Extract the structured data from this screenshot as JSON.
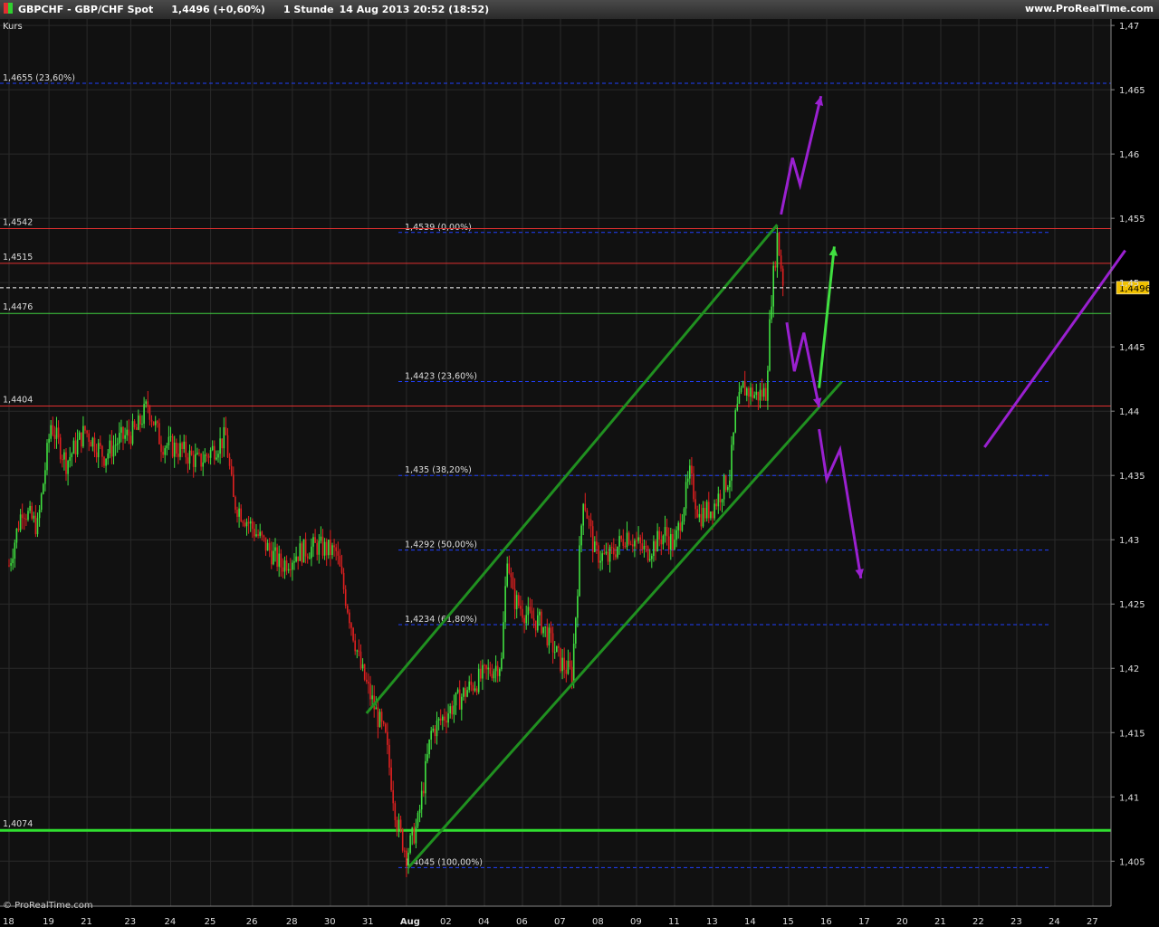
{
  "header": {
    "instrument": "GBPCHF - GBP/CHF Spot",
    "quote": "1,4496 (+0,60%)",
    "timeframe": "1 Stunde",
    "datetime": "14 Aug 2013 20:52 (18:52)",
    "site": "www.ProRealTime.com"
  },
  "chart_data": {
    "type": "candlestick",
    "panel_label": "Kurs",
    "footer": "© ProRealTime.com",
    "ylim": [
      1.4015,
      1.4705
    ],
    "y_ticks": [
      {
        "v": 1.47,
        "t": "1,47"
      },
      {
        "v": 1.465,
        "t": "1,465"
      },
      {
        "v": 1.46,
        "t": "1,46"
      },
      {
        "v": 1.455,
        "t": "1,455"
      },
      {
        "v": 1.45,
        "t": "1,45"
      },
      {
        "v": 1.445,
        "t": "1,445"
      },
      {
        "v": 1.44,
        "t": "1,44"
      },
      {
        "v": 1.435,
        "t": "1,435"
      },
      {
        "v": 1.43,
        "t": "1,43"
      },
      {
        "v": 1.425,
        "t": "1,425"
      },
      {
        "v": 1.42,
        "t": "1,42"
      },
      {
        "v": 1.415,
        "t": "1,415"
      },
      {
        "v": 1.41,
        "t": "1,41"
      },
      {
        "v": 1.405,
        "t": "1,405"
      }
    ],
    "x_ticks": [
      {
        "t": "18",
        "i": 0
      },
      {
        "t": "19",
        "i": 2.1
      },
      {
        "t": "21",
        "i": 4.1
      },
      {
        "t": "23",
        "i": 6.4
      },
      {
        "t": "24",
        "i": 8.5
      },
      {
        "t": "25",
        "i": 10.6
      },
      {
        "t": "26",
        "i": 12.8
      },
      {
        "t": "28",
        "i": 14.9
      },
      {
        "t": "30",
        "i": 16.9
      },
      {
        "t": "31",
        "i": 18.9
      },
      {
        "t": "Aug",
        "i": 20.9,
        "bold": true
      },
      {
        "t": "02",
        "i": 23
      },
      {
        "t": "04",
        "i": 25
      },
      {
        "t": "06",
        "i": 27
      },
      {
        "t": "07",
        "i": 29
      },
      {
        "t": "08",
        "i": 31
      },
      {
        "t": "09",
        "i": 33
      },
      {
        "t": "11",
        "i": 35
      },
      {
        "t": "13",
        "i": 37
      },
      {
        "t": "14",
        "i": 39
      },
      {
        "t": "15",
        "i": 41
      },
      {
        "t": "16",
        "i": 43
      },
      {
        "t": "17",
        "i": 45
      },
      {
        "t": "20",
        "i": 47
      },
      {
        "t": "21",
        "i": 49
      },
      {
        "t": "22",
        "i": 51
      },
      {
        "t": "23",
        "i": 53
      },
      {
        "t": "24",
        "i": 55
      },
      {
        "t": "27",
        "i": 57
      }
    ],
    "last_price": {
      "v": 1.4496,
      "t": "1,4496"
    },
    "hlines": [
      {
        "v": 1.4542,
        "t": "1,4542",
        "color": "#e03030"
      },
      {
        "v": 1.4515,
        "t": "1,4515",
        "color": "#e03030"
      },
      {
        "v": 1.4476,
        "t": "1,4476",
        "color": "#40d040"
      },
      {
        "v": 1.4404,
        "t": "1,4404",
        "color": "#e03030"
      },
      {
        "v": 1.4074,
        "t": "1,4074",
        "color": "#30e030",
        "thick": true
      }
    ],
    "fib_top_label": {
      "v": 1.4655,
      "t": "1,4655 (23,60%)"
    },
    "fib_levels": [
      {
        "v": 1.4539,
        "t": "1,4539 (0,00%)"
      },
      {
        "v": 1.4423,
        "t": "1,4423 (23,60%)"
      },
      {
        "v": 1.435,
        "t": "1,435 (38,20%)"
      },
      {
        "v": 1.4292,
        "t": "1,4292 (50,00%)"
      },
      {
        "v": 1.4234,
        "t": "1,4234 (61,80%)"
      },
      {
        "v": 1.4045,
        "t": "1,4045 (100,00%)"
      }
    ],
    "channel_lines": [
      {
        "x1": 18.8,
        "y1": 1.4165,
        "x2": 40.4,
        "y2": 1.4545
      },
      {
        "x1": 21.0,
        "y1": 1.4045,
        "x2": 43.8,
        "y2": 1.4423
      }
    ],
    "arrows": [
      {
        "color": "#9a20d0",
        "pts": [
          [
            40.6,
            1.4553
          ],
          [
            41.2,
            1.4597
          ],
          [
            41.6,
            1.4576
          ],
          [
            42.7,
            1.4645
          ]
        ],
        "head": true
      },
      {
        "color": "#9a20d0",
        "pts": [
          [
            40.9,
            1.4469
          ],
          [
            41.3,
            1.4431
          ],
          [
            41.8,
            1.4461
          ],
          [
            42.6,
            1.4403
          ]
        ],
        "head": true
      },
      {
        "color": "#40e040",
        "pts": [
          [
            42.6,
            1.4418
          ],
          [
            43.4,
            1.4528
          ]
        ],
        "head": true
      },
      {
        "color": "#9a20d0",
        "pts": [
          [
            42.6,
            1.4386
          ],
          [
            43.0,
            1.4347
          ],
          [
            43.7,
            1.437
          ],
          [
            44.8,
            1.427
          ]
        ],
        "head": true
      },
      {
        "color": "#9a20d0",
        "pts": [
          [
            51.3,
            1.4372
          ],
          [
            58.7,
            1.4525
          ]
        ],
        "head": false
      }
    ],
    "price_keypoints": [
      [
        0,
        1.428
      ],
      [
        0.7,
        1.4325
      ],
      [
        1.5,
        1.431
      ],
      [
        2.2,
        1.439
      ],
      [
        3.0,
        1.436
      ],
      [
        4.0,
        1.4385
      ],
      [
        5.0,
        1.4365
      ],
      [
        5.8,
        1.4378
      ],
      [
        6.7,
        1.4385
      ],
      [
        7.3,
        1.4405
      ],
      [
        8.0,
        1.4375
      ],
      [
        9.0,
        1.437
      ],
      [
        10.0,
        1.436
      ],
      [
        11.4,
        1.438
      ],
      [
        11.8,
        1.433
      ],
      [
        13.0,
        1.4305
      ],
      [
        14.3,
        1.428
      ],
      [
        15.2,
        1.429
      ],
      [
        16.2,
        1.4295
      ],
      [
        17.2,
        1.429
      ],
      [
        17.8,
        1.4248
      ],
      [
        18.5,
        1.42
      ],
      [
        19.2,
        1.417
      ],
      [
        19.8,
        1.4145
      ],
      [
        20.4,
        1.408
      ],
      [
        20.9,
        1.4055
      ],
      [
        21.5,
        1.408
      ],
      [
        22.2,
        1.415
      ],
      [
        23.0,
        1.4165
      ],
      [
        24.2,
        1.4185
      ],
      [
        25.0,
        1.4195
      ],
      [
        25.9,
        1.4205
      ],
      [
        26.2,
        1.429
      ],
      [
        26.5,
        1.4255
      ],
      [
        27.3,
        1.424
      ],
      [
        28.0,
        1.4235
      ],
      [
        29.0,
        1.4205
      ],
      [
        29.6,
        1.4195
      ],
      [
        30.2,
        1.4335
      ],
      [
        30.8,
        1.429
      ],
      [
        31.5,
        1.4285
      ],
      [
        32.5,
        1.4305
      ],
      [
        33.5,
        1.429
      ],
      [
        34.5,
        1.4305
      ],
      [
        35.0,
        1.4295
      ],
      [
        35.8,
        1.435
      ],
      [
        36.3,
        1.4318
      ],
      [
        37.0,
        1.4325
      ],
      [
        37.9,
        1.435
      ],
      [
        38.2,
        1.4395
      ],
      [
        38.6,
        1.4418
      ],
      [
        39.3,
        1.4412
      ],
      [
        39.8,
        1.4415
      ],
      [
        40.1,
        1.449
      ],
      [
        40.4,
        1.4536
      ],
      [
        40.75,
        1.4496
      ]
    ]
  }
}
